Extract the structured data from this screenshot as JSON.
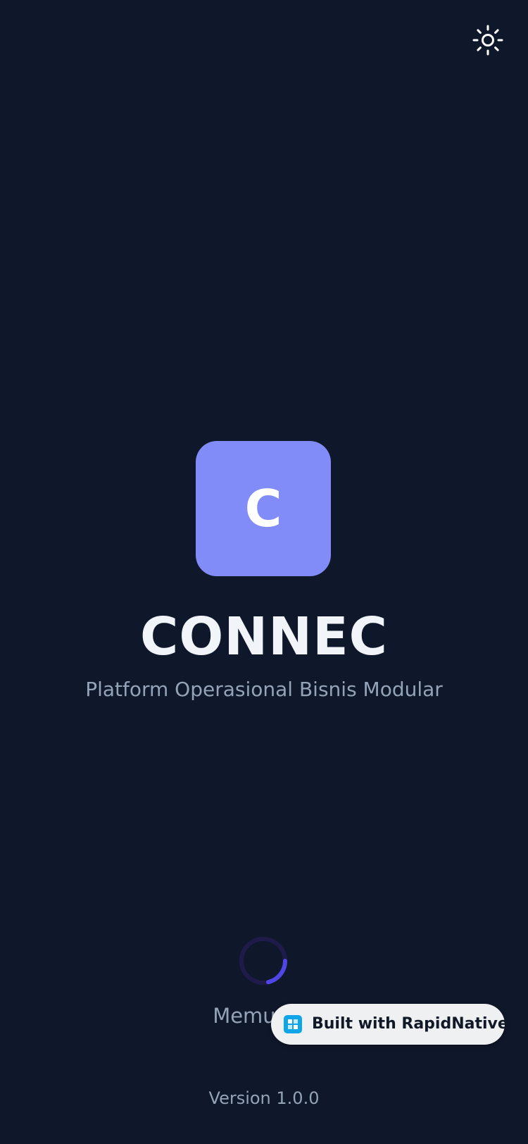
{
  "header": {
    "theme_toggle_icon": "sun-icon"
  },
  "brand": {
    "logo_letter": "C",
    "logo_color": "#818cf8",
    "app_name": "CONNEC",
    "tagline": "Platform Operasional Bisnis Modular"
  },
  "loading": {
    "text": "Memuat a",
    "spinner_track_color": "#1e1b4b",
    "spinner_arc_color": "#4f46e5"
  },
  "badge": {
    "label": "Built with RapidNative",
    "icon": "rapidnative-logo-icon"
  },
  "footer": {
    "version": "Version 1.0.0"
  },
  "colors": {
    "background": "#0f172a",
    "text_primary": "#f1f5f9",
    "text_secondary": "#94a3b8"
  }
}
